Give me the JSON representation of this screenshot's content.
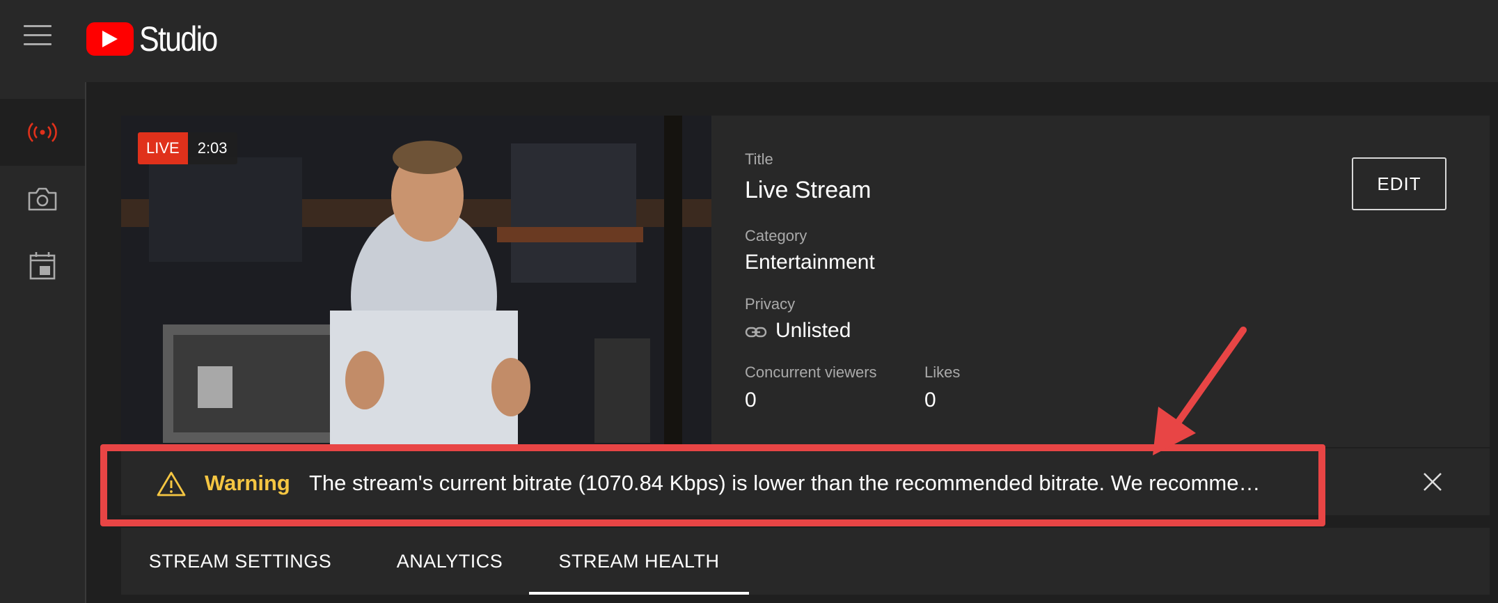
{
  "brand": {
    "name": "Studio"
  },
  "colors": {
    "accent": "#ff0000",
    "live": "#e0311b",
    "warning": "#f5c642",
    "annotation": "#e84545"
  },
  "sidebar": {
    "items": [
      {
        "icon": "live-broadcast-icon",
        "active": true
      },
      {
        "icon": "camera-icon",
        "active": false
      },
      {
        "icon": "calendar-icon",
        "active": false
      }
    ]
  },
  "video": {
    "live_label": "LIVE",
    "elapsed": "2:03"
  },
  "info": {
    "title_label": "Title",
    "title_value": "Live Stream",
    "category_label": "Category",
    "category_value": "Entertainment",
    "privacy_label": "Privacy",
    "privacy_value": "Unlisted",
    "viewers_label": "Concurrent viewers",
    "viewers_value": "0",
    "likes_label": "Likes",
    "likes_value": "0",
    "edit_label": "EDIT"
  },
  "warning": {
    "label": "Warning",
    "message": "The stream's current bitrate (1070.84 Kbps) is lower than the recommended bitrate. We recomme…"
  },
  "tabs": [
    {
      "label": "STREAM SETTINGS",
      "active": false
    },
    {
      "label": "ANALYTICS",
      "active": false
    },
    {
      "label": "STREAM HEALTH",
      "active": true
    }
  ]
}
